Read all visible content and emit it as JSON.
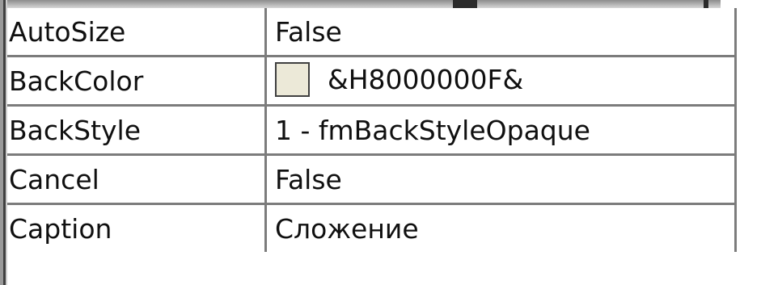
{
  "properties": [
    {
      "name": "AutoSize",
      "value": "False"
    },
    {
      "name": "BackColor",
      "value": "&H8000000F&",
      "swatch_color": "#ece9d8"
    },
    {
      "name": "BackStyle",
      "value": "1 - fmBackStyleOpaque"
    },
    {
      "name": "Cancel",
      "value": "False"
    },
    {
      "name": "Caption",
      "value": "Сложение"
    }
  ]
}
